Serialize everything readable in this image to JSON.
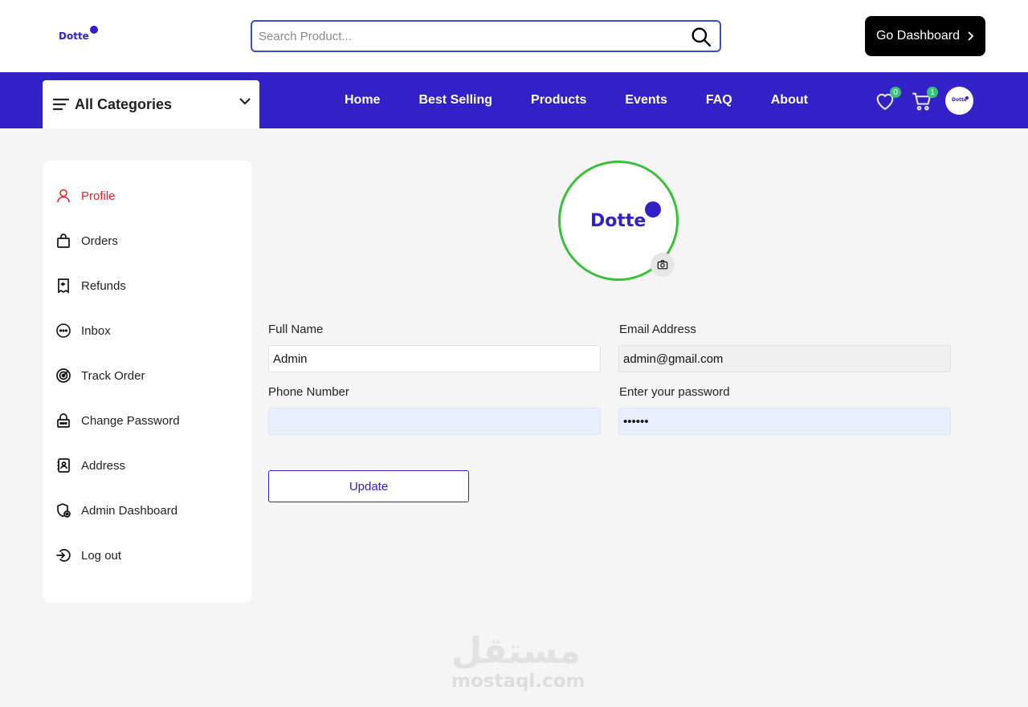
{
  "header": {
    "logo_text": "Dotte",
    "search_placeholder": "Search Product...",
    "dashboard_button": "Go Dashboard"
  },
  "nav": {
    "categories_label": "All Categories",
    "links": [
      "Home",
      "Best Selling",
      "Products",
      "Events",
      "FAQ",
      "About"
    ],
    "wishlist_count": "0",
    "cart_count": "1",
    "avatar_text": "Dotte"
  },
  "sidebar": {
    "items": [
      {
        "label": "Profile",
        "icon": "user-icon",
        "active": true
      },
      {
        "label": "Orders",
        "icon": "shopping-bag-icon"
      },
      {
        "label": "Refunds",
        "icon": "receipt-refund-icon"
      },
      {
        "label": "Inbox",
        "icon": "chat-icon"
      },
      {
        "label": "Track Order",
        "icon": "radar-icon"
      },
      {
        "label": "Change Password",
        "icon": "lock-icon"
      },
      {
        "label": "Address",
        "icon": "address-book-icon"
      },
      {
        "label": "Admin Dashboard",
        "icon": "admin-shield-icon"
      },
      {
        "label": "Log out",
        "icon": "logout-icon"
      }
    ]
  },
  "profile": {
    "avatar_text": "Dotte",
    "form": {
      "full_name_label": "Full Name",
      "full_name_value": "Admin",
      "email_label": "Email Address",
      "email_value": "admin@gmail.com",
      "phone_label": "Phone Number",
      "phone_value": "",
      "password_label": "Enter your password",
      "password_value": "••••••",
      "update_button": "Update"
    }
  },
  "watermark": {
    "arabic": "مستقل",
    "latin": "mostaql.com"
  },
  "colors": {
    "brand": "#3321c8",
    "active_item": "#e3262c",
    "badge": "#3bc177",
    "avatar_ring": "#3bc03e"
  }
}
